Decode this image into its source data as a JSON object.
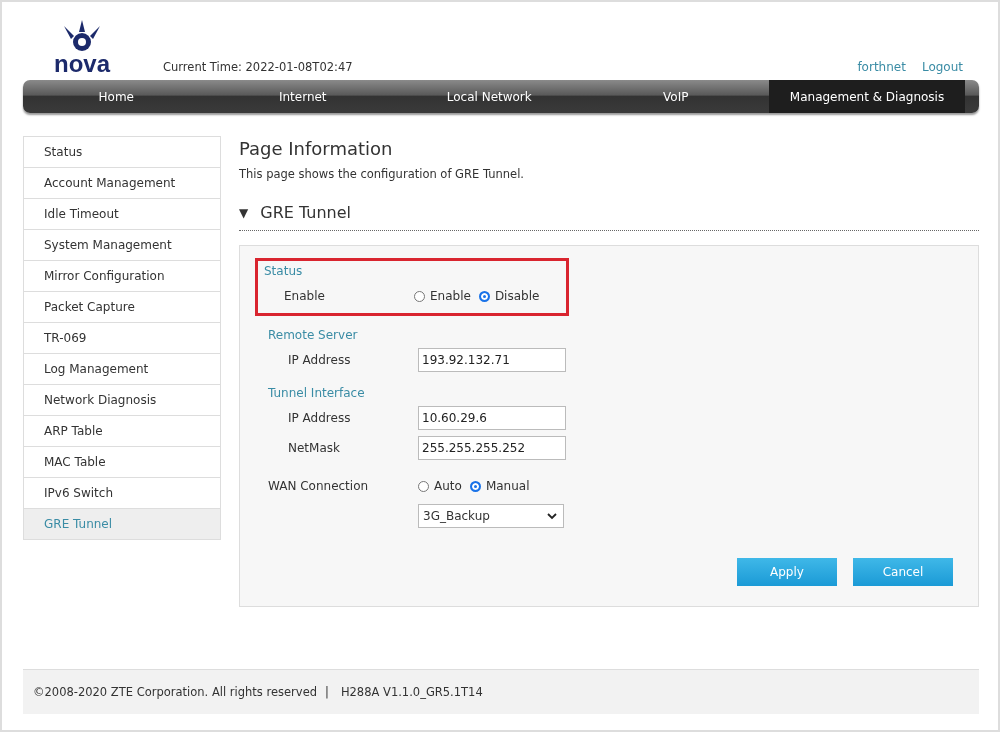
{
  "header": {
    "logo_text": "nova",
    "current_time": "Current Time: 2022-01-08T02:47",
    "user_links": [
      "forthnet",
      "Logout"
    ]
  },
  "nav": [
    {
      "label": "Home",
      "selected": false
    },
    {
      "label": "Internet",
      "selected": false
    },
    {
      "label": "Local Network",
      "selected": false
    },
    {
      "label": "VoIP",
      "selected": false
    },
    {
      "label": "Management & Diagnosis",
      "selected": true
    }
  ],
  "sidebar": {
    "items": [
      {
        "label": "Status",
        "selected": false
      },
      {
        "label": "Account Management",
        "selected": false
      },
      {
        "label": "Idle Timeout",
        "selected": false
      },
      {
        "label": "System Management",
        "selected": false
      },
      {
        "label": "Mirror Configuration",
        "selected": false
      },
      {
        "label": "Packet Capture",
        "selected": false
      },
      {
        "label": "TR-069",
        "selected": false
      },
      {
        "label": "Log Management",
        "selected": false
      },
      {
        "label": "Network Diagnosis",
        "selected": false
      },
      {
        "label": "ARP Table",
        "selected": false
      },
      {
        "label": "MAC Table",
        "selected": false
      },
      {
        "label": "IPv6 Switch",
        "selected": false
      },
      {
        "label": "GRE Tunnel",
        "selected": true
      }
    ]
  },
  "page": {
    "title": "Page Information",
    "description": "This page shows the configuration of GRE Tunnel.",
    "section_toggle": "▼",
    "section_title": "GRE Tunnel"
  },
  "form": {
    "groups": [
      {
        "title": "Status",
        "highlighted": true,
        "rows": [
          {
            "kind": "radio",
            "label": "Enable",
            "options": [
              {
                "label": "Enable",
                "selected": false
              },
              {
                "label": "Disable",
                "selected": true
              }
            ]
          }
        ]
      },
      {
        "title": "Remote Server",
        "highlighted": false,
        "rows": [
          {
            "kind": "input",
            "label": "IP Address",
            "value": "193.92.132.71"
          }
        ]
      },
      {
        "title": "Tunnel Interface",
        "highlighted": false,
        "rows": [
          {
            "kind": "input",
            "label": "IP Address",
            "value": "10.60.29.6"
          },
          {
            "kind": "input",
            "label": "NetMask",
            "value": "255.255.255.252"
          }
        ]
      },
      {
        "highlighted": false,
        "rows": [
          {
            "kind": "radio",
            "label": "WAN Connection",
            "options": [
              {
                "label": "Auto",
                "selected": false
              },
              {
                "label": "Manual",
                "selected": true
              }
            ]
          },
          {
            "kind": "select",
            "value": "3G_Backup"
          }
        ]
      }
    ],
    "buttons": [
      "Apply",
      "Cancel"
    ]
  },
  "footer": {
    "copyright": "©2008-2020 ZTE Corporation. All rights reserved",
    "separator": "|",
    "version": "H288A V1.1.0_GR5.1T14"
  }
}
